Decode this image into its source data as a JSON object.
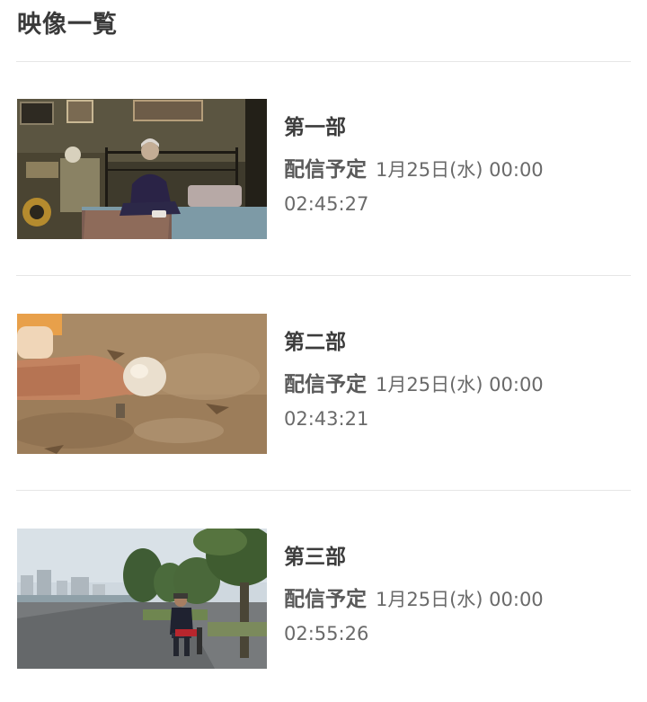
{
  "page": {
    "section_title": "映像一覧"
  },
  "videos": [
    {
      "title": "第一部",
      "schedule_label": "配信予定",
      "schedule_date": "1月25日(水) 00:00",
      "duration": "02:45:27"
    },
    {
      "title": "第二部",
      "schedule_label": "配信予定",
      "schedule_date": "1月25日(水) 00:00",
      "duration": "02:43:21"
    },
    {
      "title": "第三部",
      "schedule_label": "配信予定",
      "schedule_date": "1月25日(水) 00:00",
      "duration": "02:55:26"
    }
  ]
}
